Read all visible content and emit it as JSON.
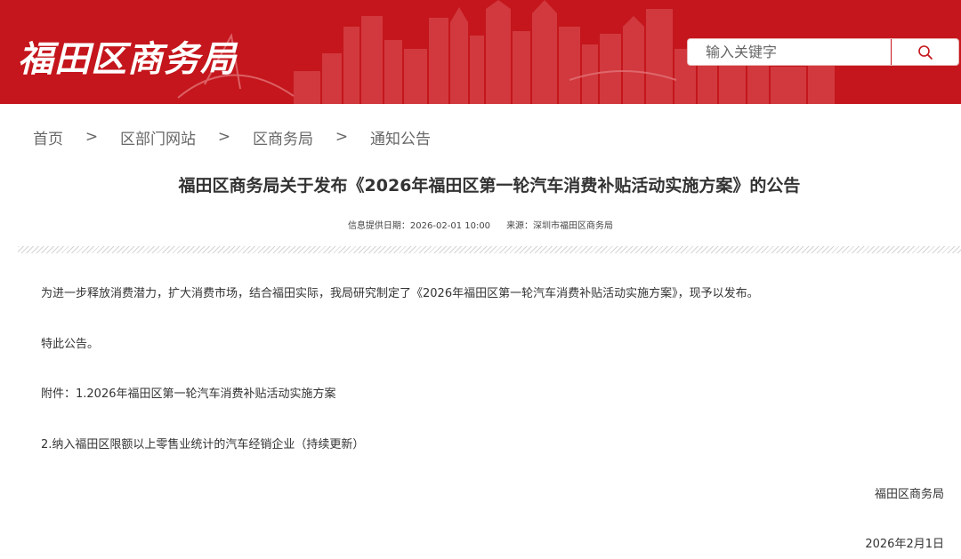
{
  "header": {
    "site_title": "福田区商务局",
    "search": {
      "placeholder": "输入关键字"
    }
  },
  "breadcrumb": {
    "items": [
      "首页",
      "区部门网站",
      "区商务局",
      "通知公告"
    ],
    "separator": ">"
  },
  "article": {
    "title": "福田区商务局关于发布《2026年福田区第一轮汽车消费补贴活动实施方案》的公告",
    "meta": {
      "publish_label": "信息提供日期：2026-02-01 10:00",
      "source_label": "来源：深圳市福田区商务局"
    },
    "paragraphs": [
      "为进一步释放消费潜力，扩大消费市场，结合福田实际，我局研究制定了《2026年福田区第一轮汽车消费补贴活动实施方案》，现予以发布。",
      "特此公告。",
      "附件：1.2026年福田区第一轮汽车消费补贴活动实施方案",
      "2.纳入福田区限额以上零售业统计的汽车经销企业（持续更新）"
    ],
    "signature": "福田区商务局",
    "date": "2026年2月1日"
  },
  "colors": {
    "brand_red": "#c4161c"
  },
  "icons": {
    "search": "search-icon"
  }
}
